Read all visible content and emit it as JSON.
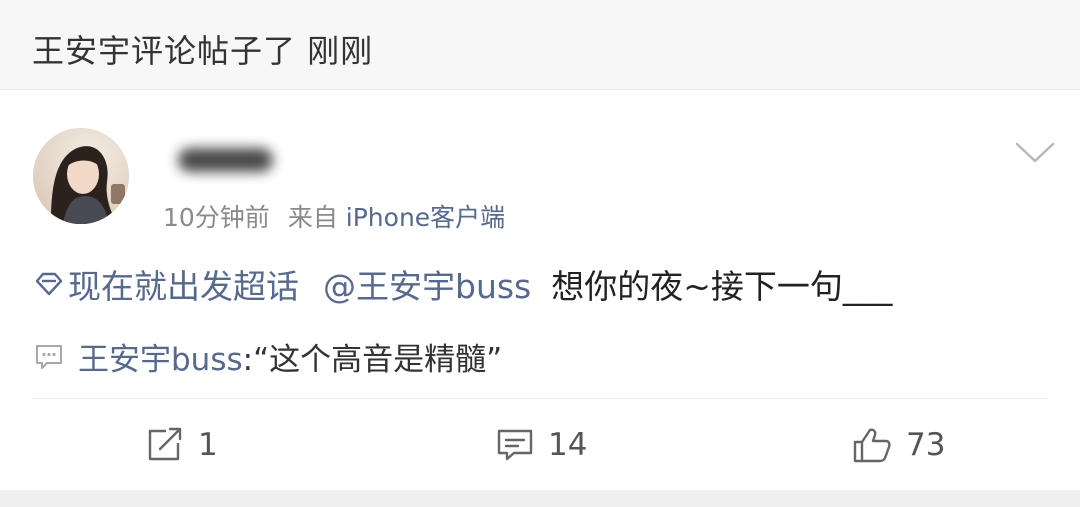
{
  "notification": {
    "text": "王安宇评论帖子了 刚刚"
  },
  "post": {
    "time": "10分钟前",
    "source_prefix": "来自",
    "source_app": "iPhone客户端",
    "topic": "现在就出发超话",
    "mention": "@王安宇buss",
    "body": "想你的夜~接下一句___"
  },
  "comment": {
    "author": "王安宇buss",
    "text": ":“这个高音是精髓”"
  },
  "actions": {
    "repost_count": "1",
    "comment_count": "14",
    "like_count": "73"
  },
  "colors": {
    "link": "#56698f",
    "meta": "#8a8a8a",
    "header_bg": "#f7f7f7"
  },
  "icons": [
    "topic-diamond-icon",
    "chevron-down-icon",
    "comment-bubble-icon",
    "repost-icon",
    "comment-icon",
    "like-icon"
  ]
}
